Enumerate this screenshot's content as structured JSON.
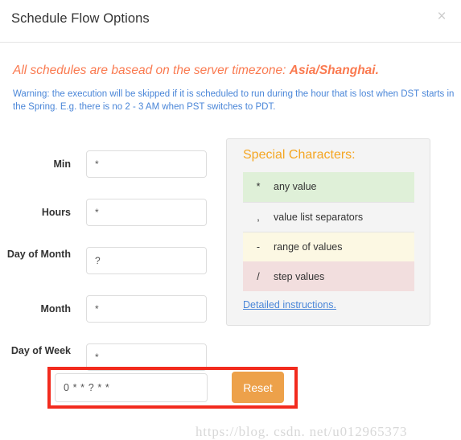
{
  "dialog": {
    "title": "Schedule Flow Options",
    "close_label": "×"
  },
  "notices": {
    "timezone_prefix": "All schedules are basead on the server timezone: ",
    "timezone_name": "Asia/Shanghai.",
    "dst_warning": "Warning: the execution will be skipped if it is scheduled to run during the hour that is lost when DST starts in the Spring. E.g. there is no 2 - 3 AM when PST switches to PDT."
  },
  "form": {
    "fields": [
      {
        "label": "Min",
        "value": "*",
        "placeholder": "*"
      },
      {
        "label": "Hours",
        "value": "*",
        "placeholder": "*"
      },
      {
        "label": "Day of Month",
        "value": "?",
        "placeholder": "?"
      },
      {
        "label": "Month",
        "value": "*",
        "placeholder": "*"
      },
      {
        "label": "Day of Week",
        "value": "*",
        "placeholder": "*"
      }
    ]
  },
  "special_characters": {
    "title": "Special Characters:",
    "rows": [
      {
        "symbol": "*",
        "description": "any value",
        "color": "#dff0d8"
      },
      {
        "symbol": ",",
        "description": "value list separators",
        "color": "#ffffff"
      },
      {
        "symbol": "-",
        "description": "range of values",
        "color": "#fcf8e3"
      },
      {
        "symbol": "/",
        "description": "step values",
        "color": "#f2dede"
      }
    ],
    "link_label": "Detailed instructions."
  },
  "cron": {
    "expression": "0 * * ? * *",
    "placeholder": "0 * * ? * *",
    "reset_label": "Reset",
    "highlight_color": "#f22b1e"
  },
  "watermark": {
    "text": "https://blog. csdn. net/u012965373"
  },
  "colors": {
    "accent_orange": "#f5a623",
    "notice_orange": "#fa7a50",
    "link_blue": "#4a86d8",
    "button_orange": "#eda14a"
  }
}
